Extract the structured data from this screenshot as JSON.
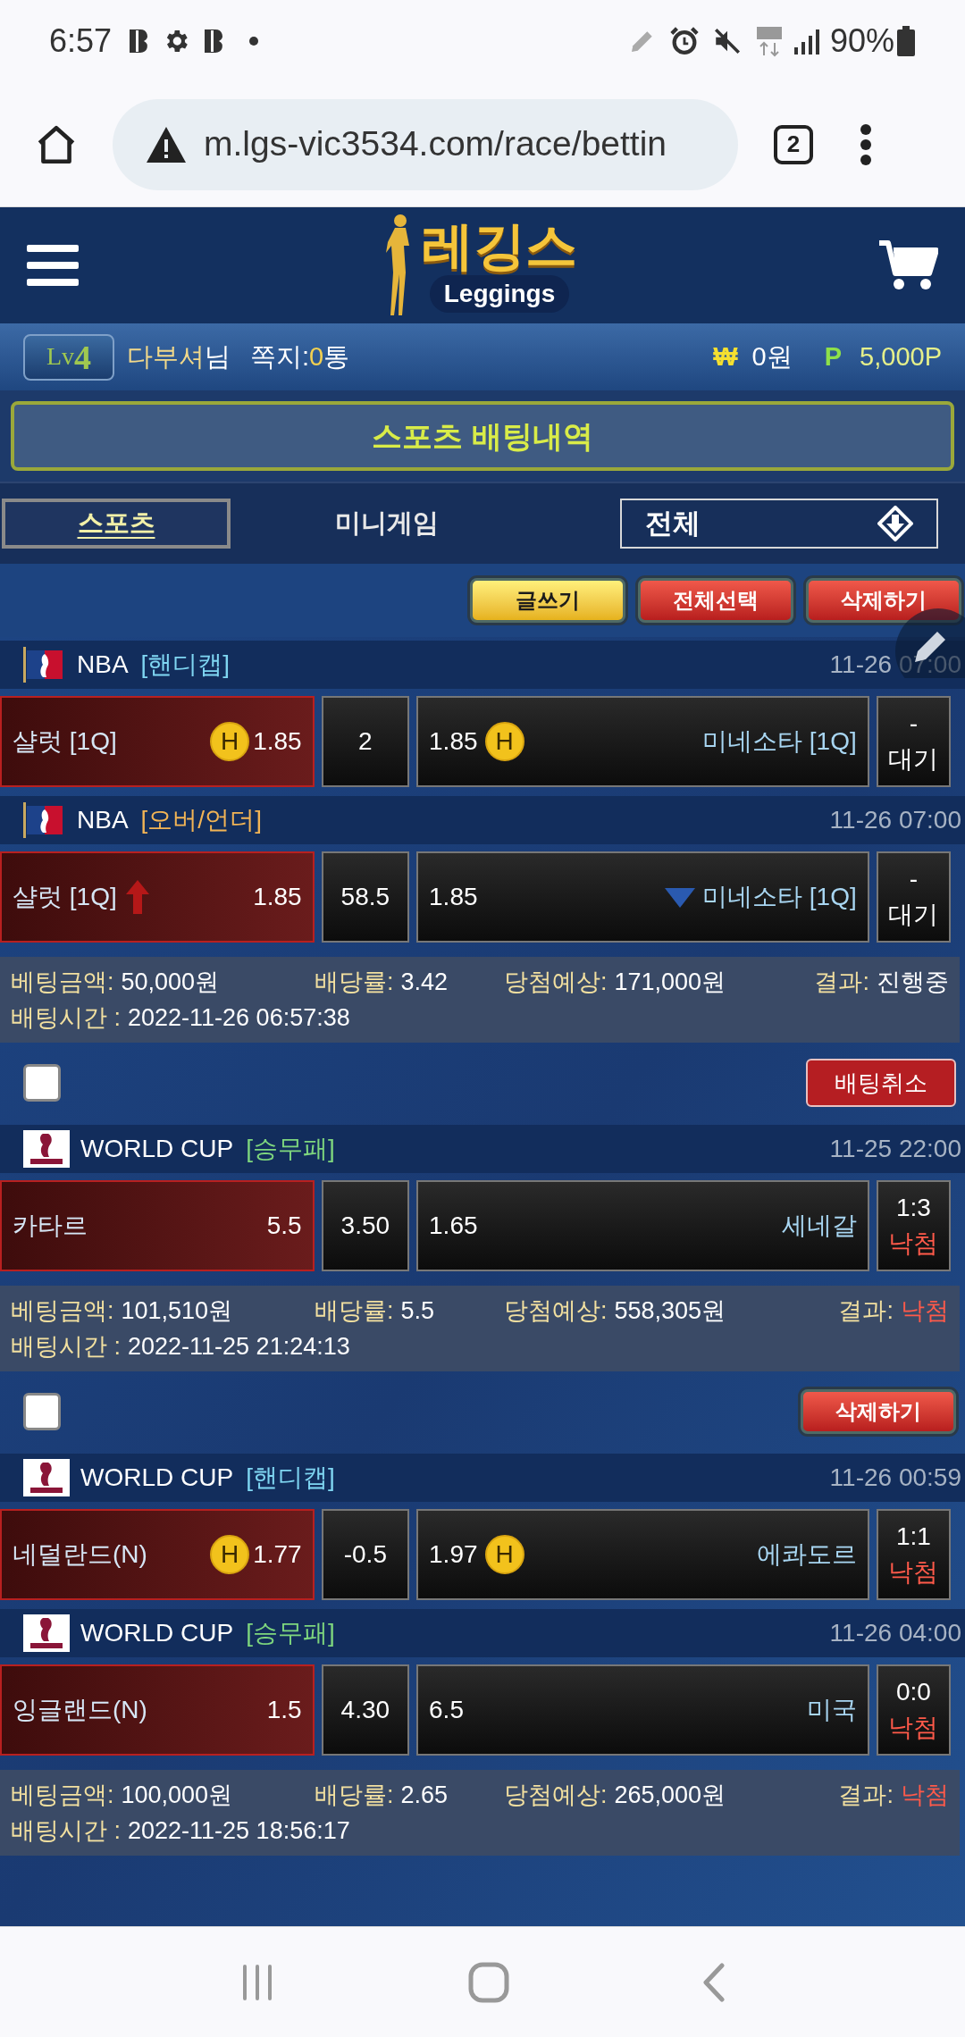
{
  "status_bar": {
    "time": "6:57",
    "battery": "90%"
  },
  "browser": {
    "url": "m.lgs-vic3534.com/race/bettin",
    "tab_count": "2"
  },
  "header": {
    "logo_text": "레깅스",
    "logo_sub": "Leggings"
  },
  "user_bar": {
    "lv_label": "Lv",
    "lv_number": "4",
    "name": "다부셔",
    "honorific": "님",
    "messages_label": "쪽지:",
    "messages_count": "0",
    "messages_unit": "통",
    "cash_symbol": "₩",
    "cash": "0원",
    "points_symbol": "P",
    "points": "5,000P"
  },
  "page_title": "스포츠 배팅내역",
  "tabs": [
    {
      "label": "스포츠",
      "selected": true
    },
    {
      "label": "미니게임",
      "selected": false
    }
  ],
  "filter": {
    "value": "전체"
  },
  "toolbar": [
    {
      "label": "글쓰기",
      "kind": "yellow"
    },
    {
      "label": "전체선택",
      "kind": "red"
    },
    {
      "label": "삭제하기",
      "kind": "red"
    }
  ],
  "groups": [
    {
      "matches": [
        {
          "kind": "nba",
          "league": "NBA",
          "market": "[핸디캡]",
          "color": "#7fd6f2",
          "time": "11-26 07:00",
          "home": "샬럿 [1Q]",
          "home_badge": "H",
          "home_odds": "1.85",
          "line": "2",
          "away_odds": "1.85",
          "away_badge": "H",
          "away": "미네소타 [1Q]",
          "score": "-",
          "result": {
            "text": "대기",
            "color": "#ffffff"
          }
        },
        {
          "kind": "nba",
          "league": "NBA",
          "market": "[오버/언더]",
          "color": "#f2b455",
          "time": "11-26 07:00",
          "home": "샬럿 [1Q]",
          "home_up": true,
          "home_odds": "1.85",
          "line": "58.5",
          "away_odds": "1.85",
          "away_down": true,
          "away": "미네소타 [1Q]",
          "score": "-",
          "result": {
            "text": "대기",
            "color": "#ffffff"
          }
        }
      ],
      "summary": {
        "amount_label": "베팅금액:",
        "amount": "50,000원",
        "odds_label": "배당률:",
        "odds": "3.42",
        "expected_label": "당첨예상:",
        "expected": "171,000원",
        "result_label": "결과:",
        "result": {
          "text": "진행중",
          "color": "#ffffff"
        },
        "time_label": "배팅시간 :",
        "time": "2022-11-26 06:57:38"
      }
    },
    {
      "header": {
        "checked": false,
        "button": {
          "label": "배팅취소",
          "kind": "flat-red"
        }
      },
      "matches": [
        {
          "kind": "worldcup",
          "league": "WORLD CUP",
          "market": "[승무패]",
          "color": "#7ed67e",
          "time": "11-25 22:00",
          "home": "카타르",
          "home_odds": "5.5",
          "line": "3.50",
          "away_odds": "1.65",
          "away": "세네갈",
          "score": "1:3",
          "result": {
            "text": "낙첨",
            "color": "#ff5a4a"
          }
        }
      ],
      "summary": {
        "amount_label": "베팅금액:",
        "amount": "101,510원",
        "odds_label": "배당률:",
        "odds": "5.5",
        "expected_label": "당첨예상:",
        "expected": "558,305원",
        "result_label": "결과:",
        "result": {
          "text": "낙첨",
          "color": "#ff5a4a"
        },
        "time_label": "배팅시간 :",
        "time": "2022-11-25 21:24:13"
      }
    },
    {
      "header": {
        "checked": false,
        "button": {
          "label": "삭제하기",
          "kind": "red"
        }
      },
      "matches": [
        {
          "kind": "worldcup",
          "league": "WORLD CUP",
          "market": "[핸디캡]",
          "color": "#7fd6f2",
          "time": "11-26 00:59",
          "home": "네덜란드(N)",
          "home_badge": "H",
          "home_odds": "1.77",
          "line": "-0.5",
          "away_odds": "1.97",
          "away_badge": "H",
          "away": "에콰도르",
          "score": "1:1",
          "result": {
            "text": "낙첨",
            "color": "#ff5a4a"
          }
        },
        {
          "kind": "worldcup",
          "league": "WORLD CUP",
          "market": "[승무패]",
          "color": "#7ed67e",
          "time": "11-26 04:00",
          "home": "잉글랜드(N)",
          "home_odds": "1.5",
          "line": "4.30",
          "away_odds": "6.5",
          "away": "미국",
          "score": "0:0",
          "result": {
            "text": "낙첨",
            "color": "#ff5a4a"
          }
        }
      ],
      "summary": {
        "amount_label": "베팅금액:",
        "amount": "100,000원",
        "odds_label": "배당률:",
        "odds": "2.65",
        "expected_label": "당첨예상:",
        "expected": "265,000원",
        "result_label": "결과:",
        "result": {
          "text": "낙첨",
          "color": "#ff5a4a"
        },
        "time_label": "배팅시간 :",
        "time": "2022-11-25 18:56:17"
      }
    }
  ]
}
